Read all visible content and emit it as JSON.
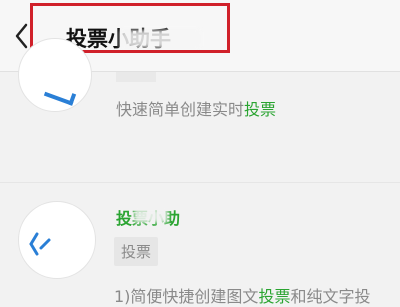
{
  "header": {
    "title": "投票小助手",
    "back_icon": "chevron-left-icon"
  },
  "card1": {
    "desc_prefix": "快速简单创建实时",
    "desc_highlight": "投票"
  },
  "card2": {
    "name": "投票小助",
    "tag": "投票",
    "desc_prefix": "1)简便快捷创建图文",
    "desc_highlight": "投票",
    "desc_suffix": "和纯文字投"
  },
  "colors": {
    "highlight_border": "#d0202a",
    "accent_green": "#2aa431",
    "accent_blue": "#2a7fd6"
  }
}
